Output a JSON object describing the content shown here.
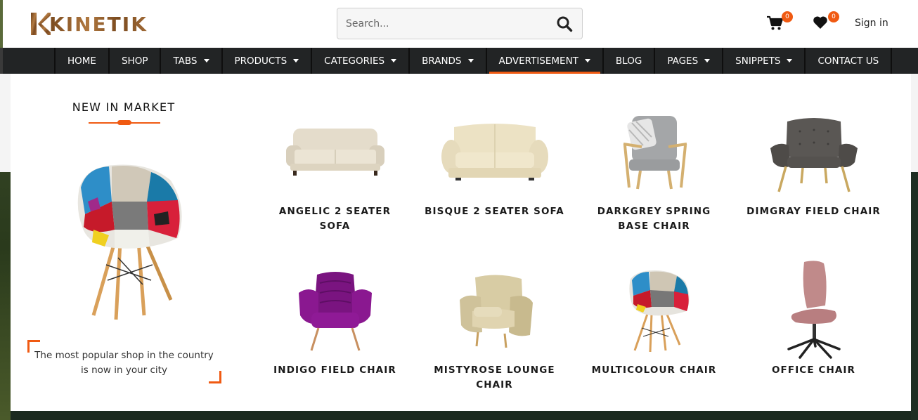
{
  "header": {
    "brand": "KINETIK",
    "search_placeholder": "Search...",
    "cart_count": "0",
    "wishlist_count": "0",
    "signin_label": "Sign in"
  },
  "nav": {
    "items": [
      {
        "label": "HOME",
        "dropdown": false
      },
      {
        "label": "SHOP",
        "dropdown": false
      },
      {
        "label": "TABS",
        "dropdown": true
      },
      {
        "label": "PRODUCTS",
        "dropdown": true
      },
      {
        "label": "CATEGORIES",
        "dropdown": true
      },
      {
        "label": "BRANDS",
        "dropdown": true
      },
      {
        "label": "ADVERTISEMENT",
        "dropdown": true,
        "active": true
      },
      {
        "label": "BLOG",
        "dropdown": false
      },
      {
        "label": "PAGES",
        "dropdown": true
      },
      {
        "label": "SNIPPETS",
        "dropdown": true
      },
      {
        "label": "CONTACT US",
        "dropdown": false
      }
    ]
  },
  "mega": {
    "promo_title": "NEW IN MARKET",
    "promo_text": "The most popular shop in the country is now in your city",
    "products": [
      {
        "name": "ANGELIC 2 SEATER SOFA",
        "icon": "sofa-image"
      },
      {
        "name": "BISQUE 2 SEATER SOFA",
        "icon": "sofa-image"
      },
      {
        "name": "DARKGREY SPRING BASE CHAIR",
        "icon": "chair-image"
      },
      {
        "name": "DIMGRAY FIELD CHAIR",
        "icon": "chair-image"
      },
      {
        "name": "INDIGO FIELD CHAIR",
        "icon": "chair-image"
      },
      {
        "name": "MISTYROSE LOUNGE CHAIR",
        "icon": "chair-image"
      },
      {
        "name": "MULTICOLOUR CHAIR",
        "icon": "chair-image"
      },
      {
        "name": "OFFICE CHAIR",
        "icon": "chair-image"
      }
    ]
  },
  "colors": {
    "accent": "#f05a12",
    "nav_bg": "#222425"
  }
}
